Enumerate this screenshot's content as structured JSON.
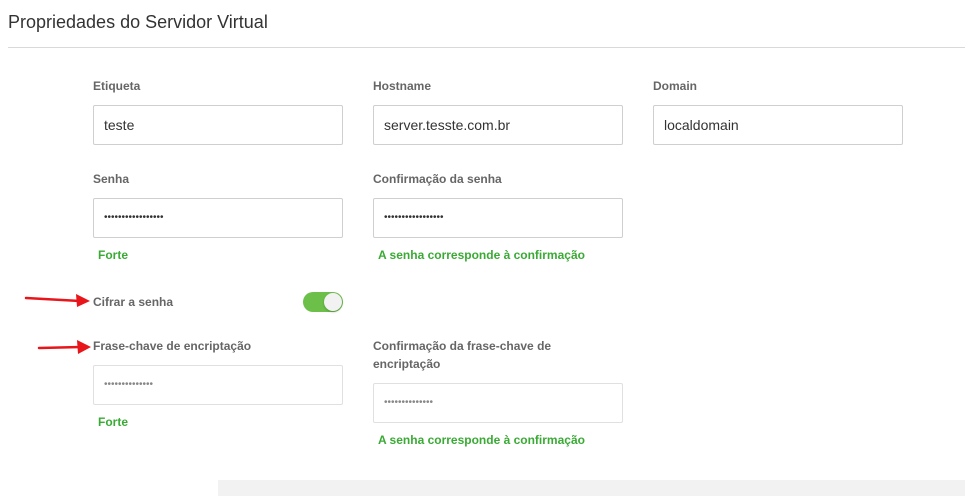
{
  "header": {
    "title": "Propriedades do Servidor Virtual"
  },
  "form": {
    "label_field": {
      "label": "Etiqueta",
      "value": "teste"
    },
    "hostname_field": {
      "label": "Hostname",
      "value": "server.tesste.com.br"
    },
    "domain_field": {
      "label": "Domain",
      "value": "localdomain"
    },
    "password_field": {
      "label": "Senha",
      "value": "•••••••••••••••••",
      "strength": "Forte"
    },
    "password_confirm_field": {
      "label": "Confirmação da senha",
      "value": "•••••••••••••••••",
      "match_status": "A senha corresponde à confirmação"
    },
    "encrypt_toggle": {
      "label": "Cifrar a senha",
      "state": "on"
    },
    "passphrase_field": {
      "label": "Frase-chave de encriptação",
      "value": "••••••••••••••",
      "strength": "Forte"
    },
    "passphrase_confirm_field": {
      "label": "Confirmação da frase-chave de encriptação",
      "value": "••••••••••••••",
      "match_status": "A senha corresponde à confirmação"
    }
  },
  "colors": {
    "accent_green": "#6cc04a",
    "status_green": "#3aaa35",
    "annotation_red": "#e8151b"
  }
}
